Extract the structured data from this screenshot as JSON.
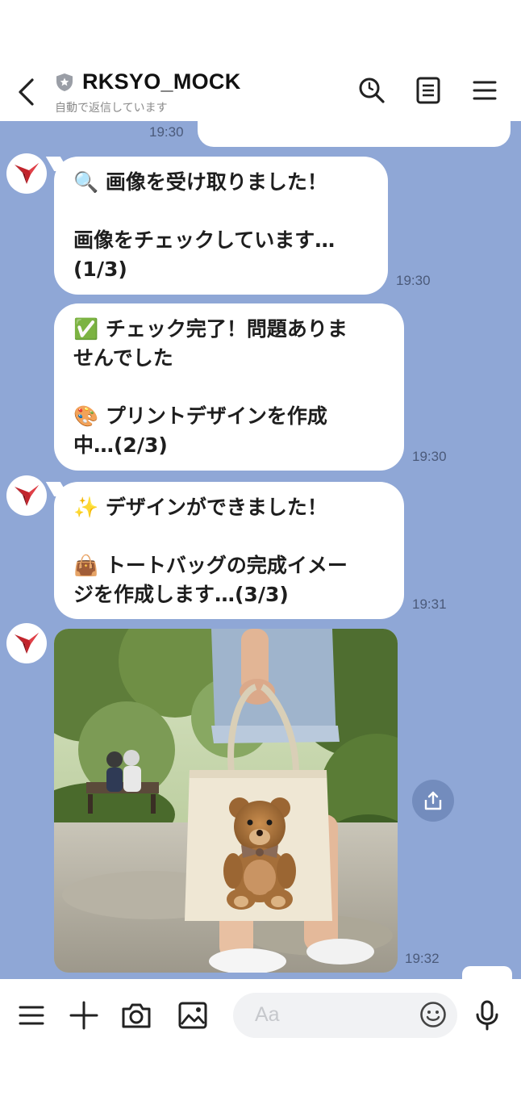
{
  "header": {
    "title": "RKSYO_MOCK",
    "subtitle": "自動で返信しています",
    "icons": [
      "back-icon",
      "shield-icon",
      "search-icon",
      "note-icon",
      "menu-icon"
    ]
  },
  "chat": {
    "background_color": "#8fa7d6",
    "top_partial_time": "19:30",
    "messages": [
      {
        "text": "🔍 画像を受け取りました！\n\n画像をチェックしています…\n(1/3)",
        "time": "19:30"
      },
      {
        "text": "✅ チェック完了！問題ありま\nせんでした\n\n🎨 プリントデザインを作成\n中…(2/3)",
        "time": "19:30"
      },
      {
        "text": "✨ デザインができました！\n\n👜 トートバッグの完成イメー\nジを作成します…(3/3)",
        "time": "19:31"
      }
    ],
    "image_message": {
      "time": "19:32"
    },
    "share_icon": "share-icon"
  },
  "bottom_bar": {
    "input_placeholder": "Aa",
    "icons": [
      "menu-icon",
      "plus-icon",
      "camera-icon",
      "image-icon",
      "emoji-icon",
      "microphone-icon"
    ]
  }
}
